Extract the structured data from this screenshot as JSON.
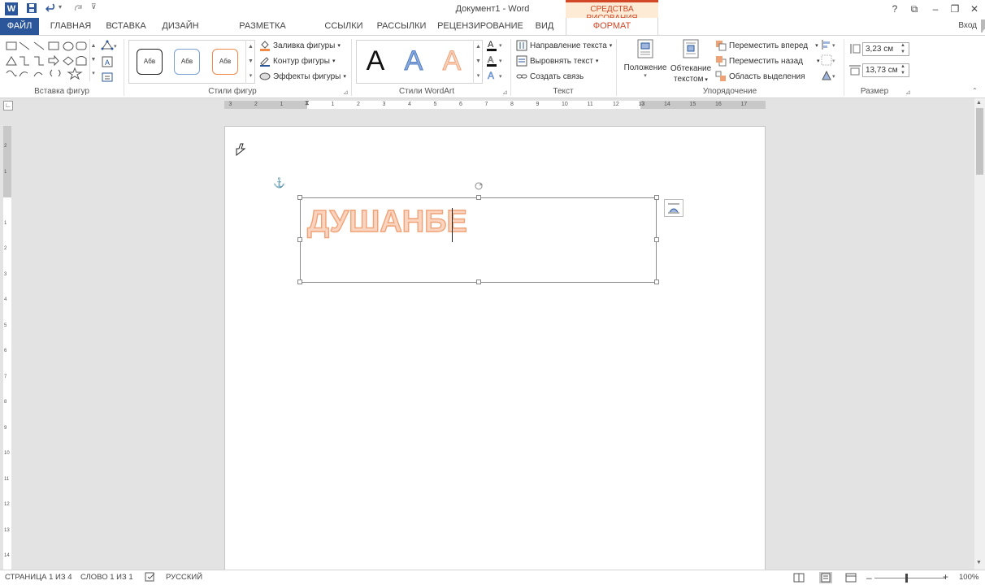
{
  "title_bar": {
    "doc_title": "Документ1 - Word",
    "context_header": "СРЕДСТВА РИСОВАНИЯ",
    "help": "?",
    "restore_ribbon": "⧉",
    "minimize": "–",
    "maximize": "❐",
    "close": "✕"
  },
  "tabs": [
    {
      "label": "ФАЙЛ"
    },
    {
      "label": "ГЛАВНАЯ"
    },
    {
      "label": "ВСТАВКА"
    },
    {
      "label": "ДИЗАЙН"
    },
    {
      "label": "РАЗМЕТКА СТРАНИЦЫ"
    },
    {
      "label": "ССЫЛКИ"
    },
    {
      "label": "РАССЫЛКИ"
    },
    {
      "label": "РЕЦЕНЗИРОВАНИЕ"
    },
    {
      "label": "ВИД"
    },
    {
      "label": "ФОРМАТ"
    }
  ],
  "login": "Вход",
  "ribbon": {
    "insert_shapes_label": "Вставка фигур",
    "shape_styles_label": "Стили фигур",
    "style_sample": "Абв",
    "fill": "Заливка фигуры",
    "outline": "Контур фигуры",
    "effects": "Эффекты фигуры",
    "wordart_label": "Стили WordArt",
    "wordart_letter": "A",
    "text_direction": "Направление текста",
    "align_text": "Выровнять текст",
    "create_link": "Создать связь",
    "text_label": "Текст",
    "position": "Положение",
    "wrap_line1": "Обтекание",
    "wrap_line2": "текстом",
    "bring_forward": "Переместить вперед",
    "send_backward": "Переместить назад",
    "selection_pane": "Область выделения",
    "arrange_label": "Упорядочение",
    "height": "3,23 см",
    "width": "13,73 см",
    "size_label": "Размер"
  },
  "ruler": {
    "marks": [
      "3",
      "2",
      "1",
      "1",
      "2",
      "3",
      "4",
      "5",
      "6",
      "7",
      "8",
      "9",
      "10",
      "11",
      "12",
      "13",
      "14",
      "15",
      "16",
      "17"
    ],
    "vmarks": [
      "2",
      "1",
      "1",
      "2",
      "3",
      "4",
      "5",
      "6",
      "7",
      "8",
      "9",
      "10",
      "11",
      "12",
      "13",
      "14"
    ]
  },
  "document": {
    "wordart_text": "ДУШАНБЕ"
  },
  "status": {
    "page": "СТРАНИЦА 1 ИЗ 4",
    "words": "СЛОВО 1 ИЗ 1",
    "language": "РУССКИЙ",
    "zoom": "100%"
  },
  "colors": {
    "accent_word": "#2b579a",
    "context_orange": "#d24726",
    "wordart_fill": "#fbd4c0",
    "wordart_stroke": "#f0a277"
  }
}
